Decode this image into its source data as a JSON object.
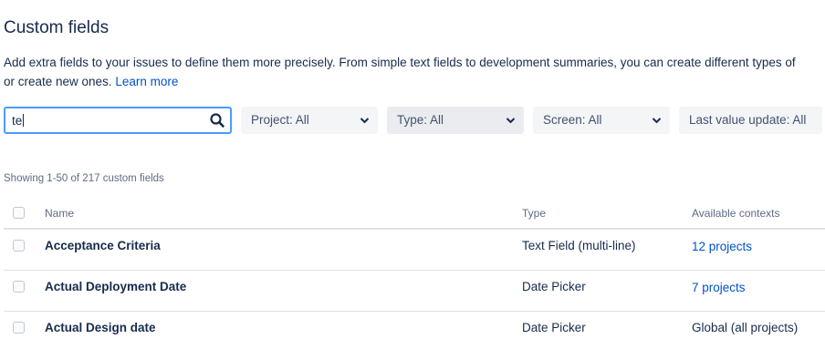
{
  "page": {
    "title": "Custom fields",
    "description_line1": "Add extra fields to your issues to define them more precisely. From simple text fields to development summaries, you can create different types of",
    "description_line2": "or create new ones.",
    "learn_more": "Learn more"
  },
  "filters": {
    "search_value": "te",
    "project": "Project: All",
    "type": "Type: All",
    "screen": "Screen: All",
    "last_value_update": "Last value update: All"
  },
  "summary": "Showing 1-50 of 217 custom fields",
  "table": {
    "headers": {
      "name": "Name",
      "type": "Type",
      "contexts": "Available contexts"
    },
    "rows": [
      {
        "name": "Acceptance Criteria",
        "type": "Text Field (multi-line)",
        "contexts": "12 projects",
        "contexts_is_link": true
      },
      {
        "name": "Actual Deployment Date",
        "type": "Date Picker",
        "contexts": "7 projects",
        "contexts_is_link": true
      },
      {
        "name": "Actual Design date",
        "type": "Date Picker",
        "contexts": "Global (all projects)",
        "contexts_is_link": false
      }
    ]
  },
  "colors": {
    "link": "#0052cc",
    "text": "#172b4d",
    "subtle": "#5e6c84",
    "focus": "#4c9aff"
  },
  "icons": {
    "search": "search-icon",
    "dropdown": "chevron-down-icon"
  }
}
